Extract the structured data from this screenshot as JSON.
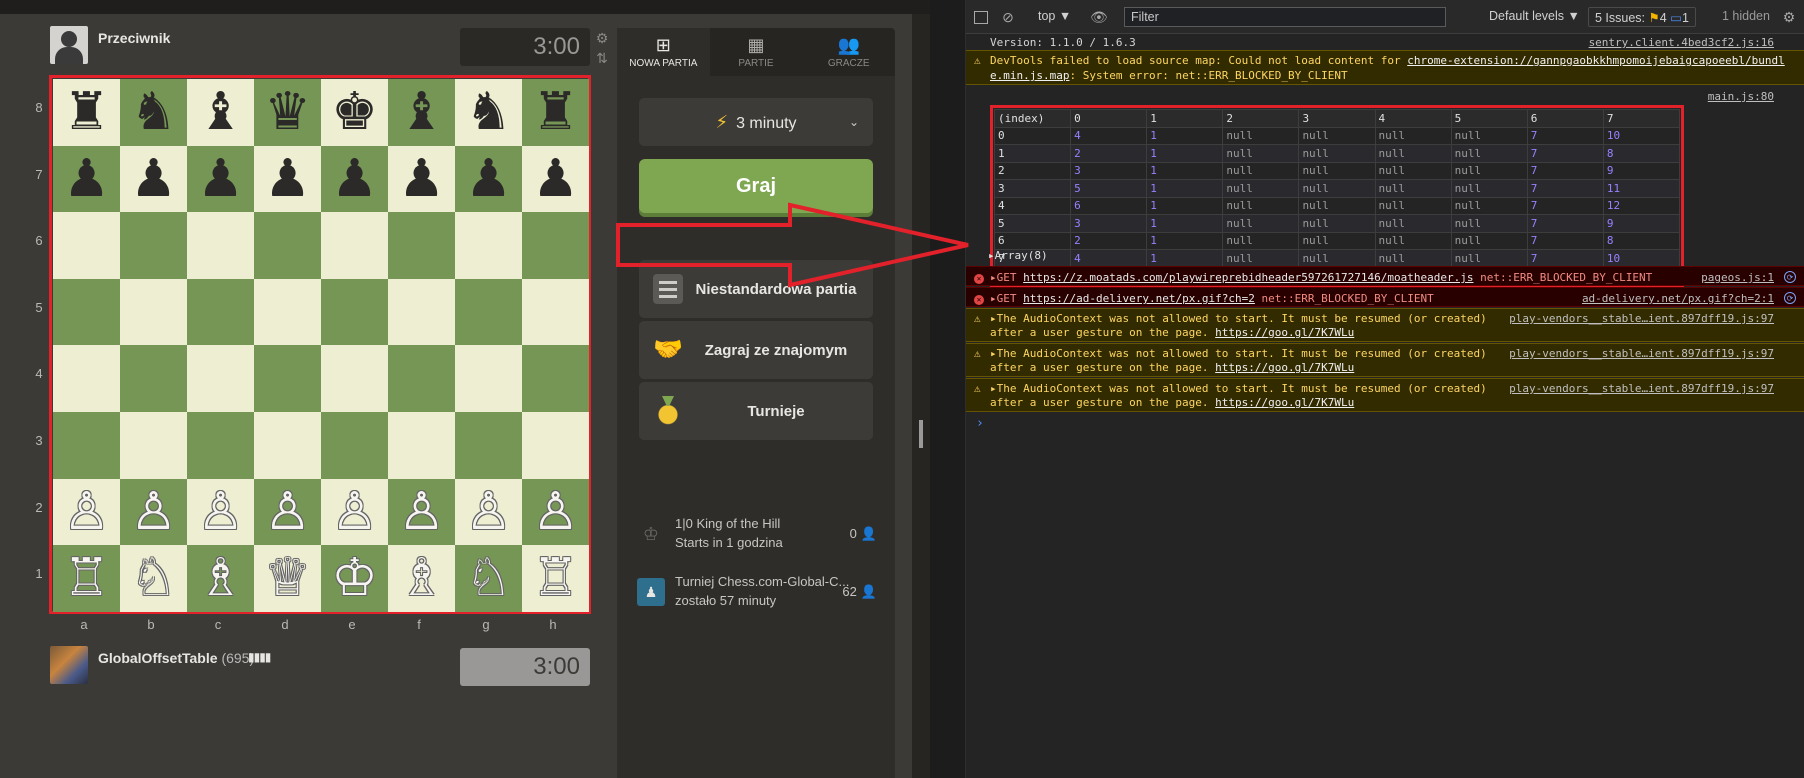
{
  "chess": {
    "opponent": {
      "name": "Przeciwnik",
      "clock": "3:00"
    },
    "player": {
      "name": "GlobalOffsetTable",
      "rating": "(695)",
      "clock": "3:00"
    },
    "board": {
      "ranks": [
        "8",
        "7",
        "6",
        "5",
        "4",
        "3",
        "2",
        "1"
      ],
      "files": [
        "a",
        "b",
        "c",
        "d",
        "e",
        "f",
        "g",
        "h"
      ],
      "rows": [
        [
          "♜",
          "♞",
          "♝",
          "♛",
          "♚",
          "♝",
          "♞",
          "♜"
        ],
        [
          "♟",
          "♟",
          "♟",
          "♟",
          "♟",
          "♟",
          "♟",
          "♟"
        ],
        [
          "",
          "",
          "",
          "",
          "",
          "",
          "",
          ""
        ],
        [
          "",
          "",
          "",
          "",
          "",
          "",
          "",
          ""
        ],
        [
          "",
          "",
          "",
          "",
          "",
          "",
          "",
          ""
        ],
        [
          "",
          "",
          "",
          "",
          "",
          "",
          "",
          ""
        ],
        [
          "♙",
          "♙",
          "♙",
          "♙",
          "♙",
          "♙",
          "♙",
          "♙"
        ],
        [
          "♖",
          "♘",
          "♗",
          "♕",
          "♔",
          "♗",
          "♘",
          "♖"
        ]
      ],
      "colors": {
        "light": "#eeeed2",
        "dark": "#769656"
      }
    },
    "tabs": [
      {
        "label": "NOWA PARTIA",
        "icon": "plus-square-icon"
      },
      {
        "label": "PARTIE",
        "icon": "board-grid-icon"
      },
      {
        "label": "GRACZE",
        "icon": "users-icon"
      }
    ],
    "time_control": "3 minuty",
    "play_label": "Graj",
    "menu": {
      "custom": "Niestandardowa partia",
      "friend": "Zagraj ze znajomym",
      "tournaments": "Turnieje"
    },
    "events": [
      {
        "title": "1|0 King of the Hill",
        "sub": "Starts in 1 godzina",
        "count": "0"
      },
      {
        "title": "Turniej Chess.com-Global-C...",
        "sub": "zostało 57 minuty",
        "count": "62"
      }
    ],
    "accent_green": "#7fa650",
    "annotation_red": "#e3212a"
  },
  "devtools": {
    "toolbar": {
      "context": "top ▼",
      "filter_placeholder": "Filter",
      "levels": "Default levels ▼",
      "issues_label": "5 Issues:",
      "issues_warn": "4",
      "issues_info": "1",
      "hidden": "1 hidden"
    },
    "messages": {
      "version": "Version: 1.1.0 / 1.6.3",
      "version_src": "sentry.client.4bed3cf2.js:16",
      "sourcemap_prefix": "DevTools failed to load source map: Could not load content for ",
      "sourcemap_link": "chrome-extension://gannpgaobkkhmpomoijebaigcapoeebl/bundle.min.js.map",
      "sourcemap_suffix": ": System error: net::ERR_BLOCKED_BY_CLIENT",
      "sourcemap_link_a": "chrome-extension://gannpgaobkkhmpomoijebaigcapoeebl/bundl",
      "sourcemap_link_b": "e.min.js.map",
      "table_src": "main.js:80",
      "array_label": "Array(8)",
      "err1_prefix": "GET ",
      "err1_url": "https://z.moatads.com/playwireprebidheader597261727146/moatheader.js",
      "err1_suffix": " net::ERR_BLOCKED_BY_CLIENT",
      "err1_src": "pageos.js:1",
      "err2_prefix": "GET ",
      "err2_url": "https://ad-delivery.net/px.gif?ch=2",
      "err2_suffix": " net::ERR_BLOCKED_BY_CLIENT",
      "err2_src": "ad-delivery.net/px.gif?ch=2:1",
      "audio_line1": "The AudioContext was not allowed to start. It must be resumed (or created)",
      "audio_line2": "after a user gesture on the page. ",
      "audio_link": "https://goo.gl/7K7WLu",
      "audio_src": "play-vendors__stable…ient.897dff19.js:97"
    },
    "table": {
      "headers": [
        "(index)",
        "0",
        "1",
        "2",
        "3",
        "4",
        "5",
        "6",
        "7"
      ],
      "rows": [
        [
          "0",
          "4",
          "1",
          "null",
          "null",
          "null",
          "null",
          "7",
          "10"
        ],
        [
          "1",
          "2",
          "1",
          "null",
          "null",
          "null",
          "null",
          "7",
          "8"
        ],
        [
          "2",
          "3",
          "1",
          "null",
          "null",
          "null",
          "null",
          "7",
          "9"
        ],
        [
          "3",
          "5",
          "1",
          "null",
          "null",
          "null",
          "null",
          "7",
          "11"
        ],
        [
          "4",
          "6",
          "1",
          "null",
          "null",
          "null",
          "null",
          "7",
          "12"
        ],
        [
          "5",
          "3",
          "1",
          "null",
          "null",
          "null",
          "null",
          "7",
          "9"
        ],
        [
          "6",
          "2",
          "1",
          "null",
          "null",
          "null",
          "null",
          "7",
          "8"
        ],
        [
          "7",
          "4",
          "1",
          "null",
          "null",
          "null",
          "null",
          "7",
          "10"
        ]
      ]
    }
  }
}
